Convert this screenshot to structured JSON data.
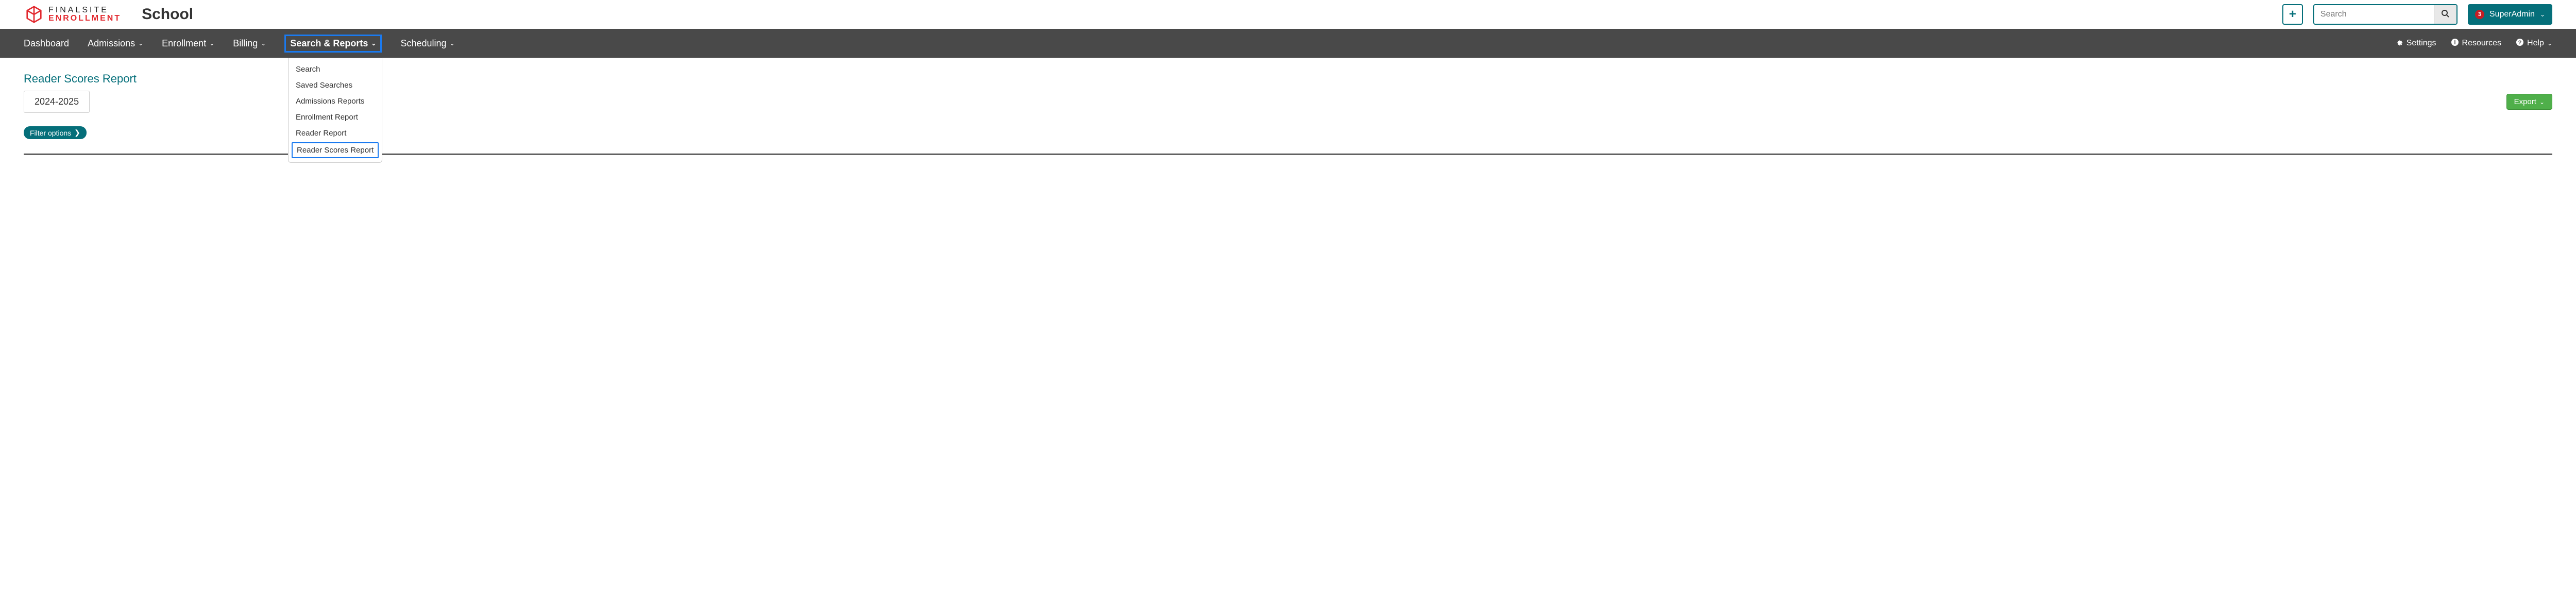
{
  "brand": {
    "line1": "FINALSITE",
    "line2": "ENROLLMENT",
    "school": "School"
  },
  "search": {
    "placeholder": "Search"
  },
  "user": {
    "name": "SuperAdmin",
    "notifications": "3"
  },
  "nav": {
    "items": [
      {
        "label": "Dashboard",
        "dropdown": false
      },
      {
        "label": "Admissions",
        "dropdown": true
      },
      {
        "label": "Enrollment",
        "dropdown": true
      },
      {
        "label": "Billing",
        "dropdown": true
      },
      {
        "label": "Search & Reports",
        "dropdown": true,
        "active": true
      },
      {
        "label": "Scheduling",
        "dropdown": true
      }
    ],
    "utils": [
      {
        "label": "Settings",
        "icon": "gear"
      },
      {
        "label": "Resources",
        "icon": "info"
      },
      {
        "label": "Help",
        "icon": "help",
        "dropdown": true
      }
    ]
  },
  "dropdown": {
    "items": [
      "Search",
      "Saved Searches",
      "Admissions Reports",
      "Enrollment Report",
      "Reader Report",
      "Reader Scores Report"
    ],
    "highlighted_index": 5
  },
  "page": {
    "title": "Reader Scores Report",
    "year": "2024-2025",
    "export_label": "Export",
    "filter_label": "Filter options"
  }
}
